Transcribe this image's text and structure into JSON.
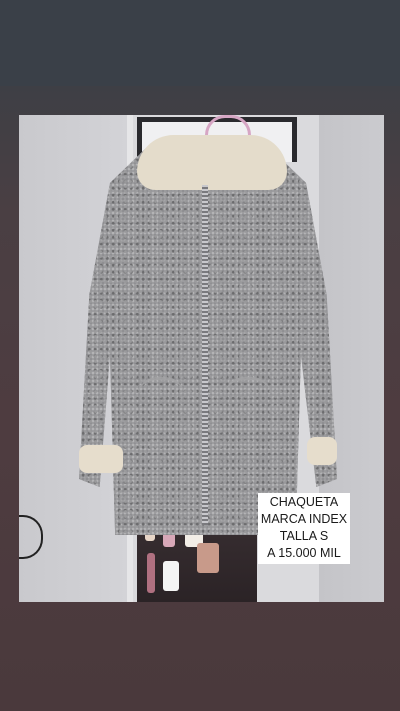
{
  "caption": {
    "line1": "CHAQUETA",
    "line2": "MARCA INDEX",
    "line3": "TALLA S",
    "line4": "A 15.000 MIL"
  },
  "colors": {
    "top_band": "#3a4048",
    "background": "#4e3c40",
    "jacket": "#8d8d90",
    "lining": "#e4dccb",
    "caption_bg": "#ffffff"
  }
}
